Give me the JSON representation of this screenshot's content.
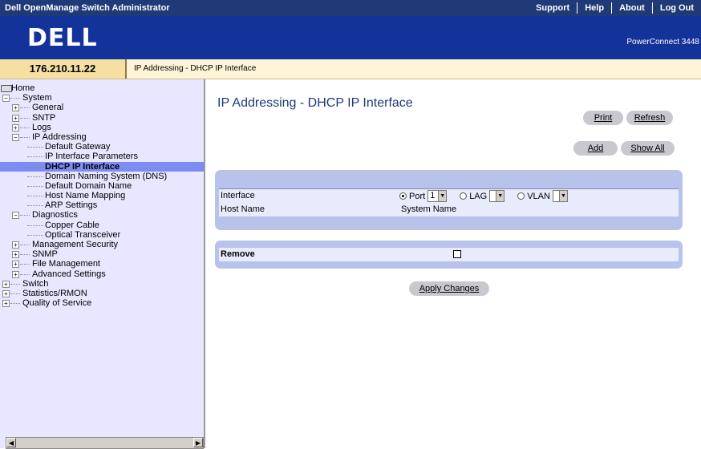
{
  "header": {
    "app_title": "Dell OpenManage Switch Administrator",
    "links": [
      "Support",
      "Help",
      "About",
      "Log Out"
    ],
    "logo": "DELL",
    "model": "PowerConnect 3448"
  },
  "info": {
    "ip": "176.210.11.22",
    "breadcrumb": "IP Addressing - DHCP IP Interface"
  },
  "tree": [
    {
      "label": "Home",
      "level": 0,
      "toggle": "",
      "active": false
    },
    {
      "label": "System",
      "level": 1,
      "toggle": "−",
      "active": false
    },
    {
      "label": "General",
      "level": 2,
      "toggle": "+",
      "active": false
    },
    {
      "label": "SNTP",
      "level": 2,
      "toggle": "+",
      "active": false
    },
    {
      "label": "Logs",
      "level": 2,
      "toggle": "+",
      "active": false
    },
    {
      "label": "IP Addressing",
      "level": 2,
      "toggle": "−",
      "active": false
    },
    {
      "label": "Default Gateway",
      "level": 3,
      "toggle": "",
      "active": false
    },
    {
      "label": "IP Interface Parameters",
      "level": 3,
      "toggle": "",
      "active": false
    },
    {
      "label": "DHCP IP Interface",
      "level": 3,
      "toggle": "",
      "active": true
    },
    {
      "label": "Domain Naming System (DNS)",
      "level": 3,
      "toggle": "",
      "active": false
    },
    {
      "label": "Default Domain Name",
      "level": 3,
      "toggle": "",
      "active": false
    },
    {
      "label": "Host Name Mapping",
      "level": 3,
      "toggle": "",
      "active": false
    },
    {
      "label": "ARP Settings",
      "level": 3,
      "toggle": "",
      "active": false
    },
    {
      "label": "Diagnostics",
      "level": 2,
      "toggle": "−",
      "active": false
    },
    {
      "label": "Copper Cable",
      "level": 3,
      "toggle": "",
      "active": false
    },
    {
      "label": "Optical Transceiver",
      "level": 3,
      "toggle": "",
      "active": false
    },
    {
      "label": "Management Security",
      "level": 2,
      "toggle": "+",
      "active": false
    },
    {
      "label": "SNMP",
      "level": 2,
      "toggle": "+",
      "active": false
    },
    {
      "label": "File Management",
      "level": 2,
      "toggle": "+",
      "active": false
    },
    {
      "label": "Advanced Settings",
      "level": 2,
      "toggle": "+",
      "active": false
    },
    {
      "label": "Switch",
      "level": 1,
      "toggle": "+",
      "active": false
    },
    {
      "label": "Statistics/RMON",
      "level": 1,
      "toggle": "+",
      "active": false
    },
    {
      "label": "Quality of Service",
      "level": 1,
      "toggle": "+",
      "active": false
    }
  ],
  "main": {
    "title": "IP Addressing - DHCP IP Interface",
    "print_label": "Print",
    "refresh_label": "Refresh",
    "add_label": "Add",
    "show_all_label": "Show All",
    "interface_label": "Interface",
    "port_label": "Port",
    "port_value": "1",
    "lag_label": "LAG",
    "lag_value": "",
    "vlan_label": "VLAN",
    "vlan_value": "",
    "selected_interface_type": "Port",
    "host_name_label": "Host Name",
    "host_name_value": "System Name",
    "remove_label": "Remove",
    "remove_checked": false,
    "apply_label": "Apply Changes"
  },
  "colors": {
    "topbar": "#1f3a77",
    "banner": "#14339a",
    "sidebar": "#e8e7ff",
    "active_node": "#7d8cf2",
    "panel": "#b8c3eb",
    "button": "#c8c8cf"
  }
}
